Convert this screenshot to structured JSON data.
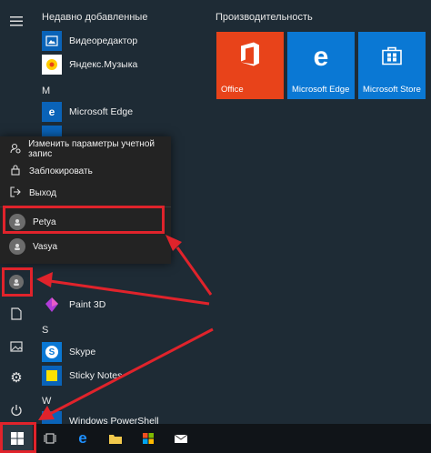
{
  "sections": {
    "recent": "Недавно добавленные",
    "m": "M",
    "s": "S",
    "w": "W"
  },
  "apps": {
    "video_editor": "Видеоредактор",
    "yandex_music": "Яндекс.Музыка",
    "edge": "Microsoft Edge",
    "paint3d": "Paint 3D",
    "skype": "Skype",
    "sticky_notes": "Sticky Notes",
    "powershell": "Windows PowerShell"
  },
  "tiles": {
    "title": "Производительность",
    "items": [
      {
        "label": "Office",
        "color": "#e8431a"
      },
      {
        "label": "Microsoft Edge",
        "color": "#0a78d4"
      },
      {
        "label": "Microsoft Store",
        "color": "#0a78d4"
      }
    ]
  },
  "flyout": {
    "change_settings": "Изменить параметры учетной запис",
    "lock": "Заблокировать",
    "sign_out": "Выход",
    "users": [
      "Petya",
      "Vasya"
    ]
  },
  "colors": {
    "highlight": "#e0232b",
    "accent": "#0a78d4"
  }
}
